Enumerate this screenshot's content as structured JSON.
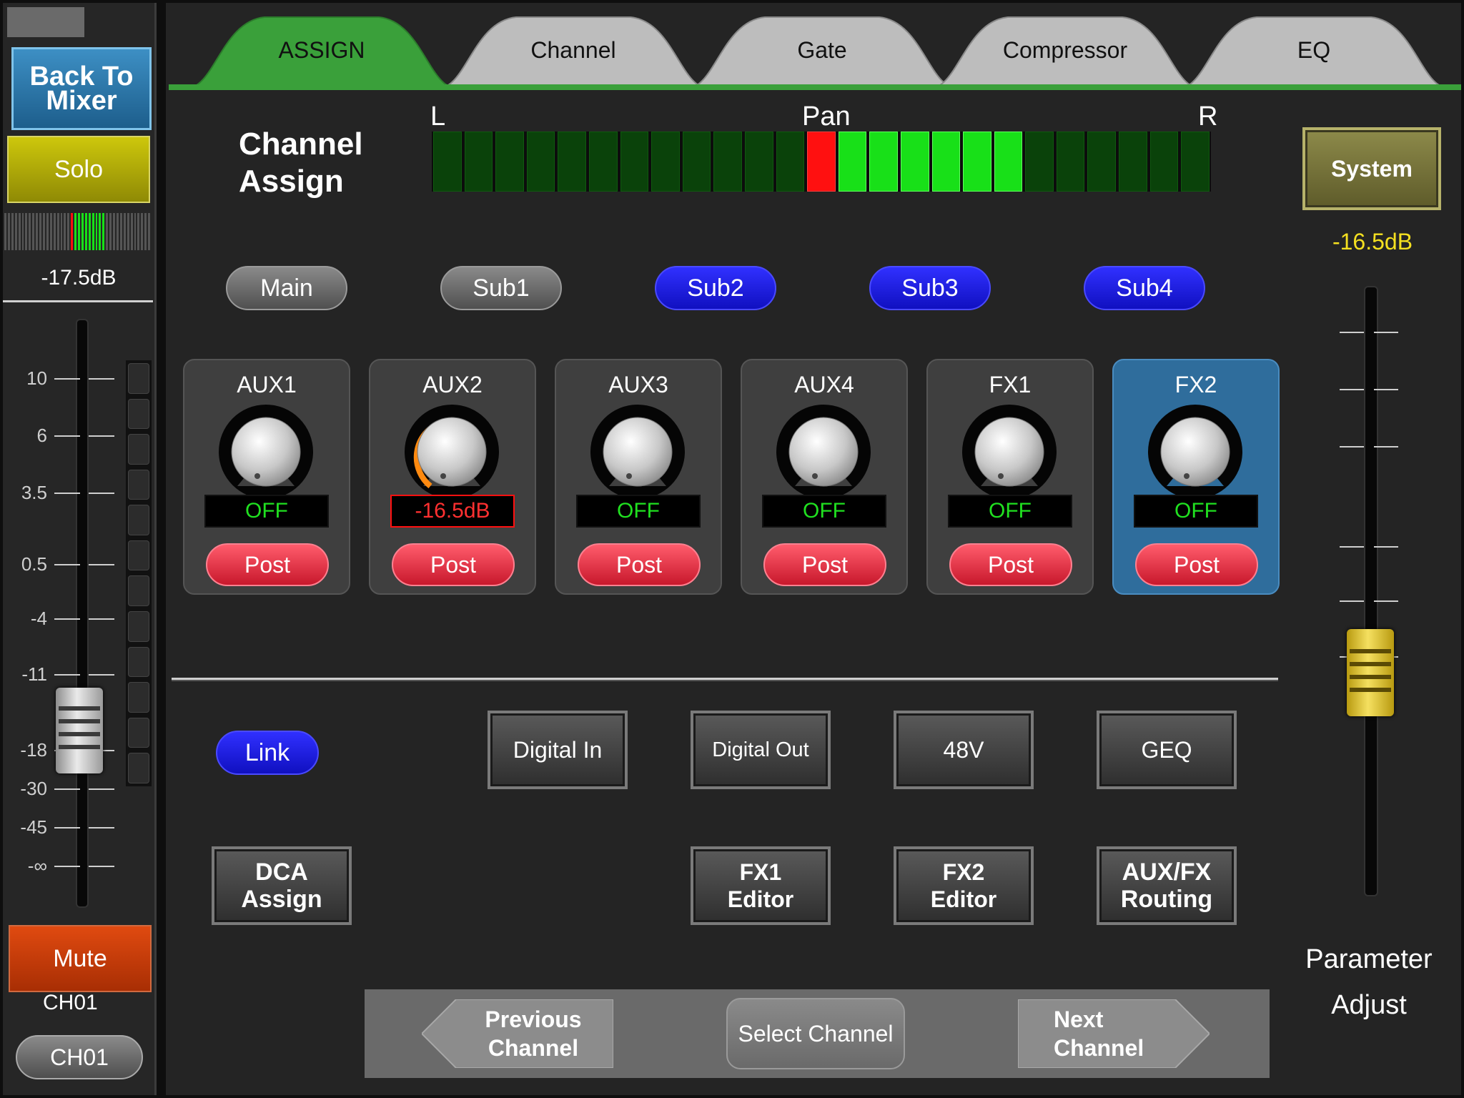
{
  "left_strip": {
    "back_to_mixer": "Back To Mixer",
    "solo": "Solo",
    "level_db": "-17.5dB",
    "fader_scale": [
      "10",
      "6",
      "3.5",
      "0.5",
      "-4",
      "-11",
      "-18",
      "-30",
      "-45",
      "-∞"
    ],
    "mute": "Mute",
    "channel_label": "CH01",
    "channel_button": "CH01"
  },
  "tabs": [
    {
      "label": "ASSIGN",
      "active": true
    },
    {
      "label": "Channel",
      "active": false
    },
    {
      "label": "Gate",
      "active": false
    },
    {
      "label": "Compressor",
      "active": false
    },
    {
      "label": "EQ",
      "active": false
    }
  ],
  "header": {
    "title_line1": "Channel",
    "title_line2": "Assign",
    "pan_left": "L",
    "pan_label": "Pan",
    "pan_right": "R"
  },
  "buses": [
    {
      "label": "Main",
      "on": false
    },
    {
      "label": "Sub1",
      "on": false
    },
    {
      "label": "Sub2",
      "on": true
    },
    {
      "label": "Sub3",
      "on": true
    },
    {
      "label": "Sub4",
      "on": true
    }
  ],
  "aux_sends": [
    {
      "name": "AUX1",
      "value": "OFF",
      "mode": "Post"
    },
    {
      "name": "AUX2",
      "value": "-16.5dB",
      "mode": "Post"
    },
    {
      "name": "AUX3",
      "value": "OFF",
      "mode": "Post"
    },
    {
      "name": "AUX4",
      "value": "OFF",
      "mode": "Post"
    },
    {
      "name": "FX1",
      "value": "OFF",
      "mode": "Post"
    },
    {
      "name": "FX2",
      "value": "OFF",
      "mode": "Post",
      "selected": true
    }
  ],
  "controls": {
    "link": "Link",
    "digital_in": "Digital In",
    "digital_out": "Digital Out",
    "phantom": "48V",
    "geq": "GEQ",
    "dca_assign": "DCA Assign",
    "fx1_editor": "FX1 Editor",
    "fx2_editor": "FX2 Editor",
    "aux_fx_routing": "AUX/FX Routing"
  },
  "nav": {
    "previous": "Previous Channel",
    "select": "Select Channel",
    "next": "Next Channel"
  },
  "right": {
    "system": "System",
    "value_db": "-16.5dB",
    "param_line1": "Parameter",
    "param_line2": "Adjust"
  },
  "colors": {
    "tab_active": "#3aa03a",
    "bus_on": "#2020e0",
    "post": "#e0283c",
    "mute": "#c83a08",
    "solo": "#b5b00a",
    "fx_selected": "#2f6d9c"
  }
}
